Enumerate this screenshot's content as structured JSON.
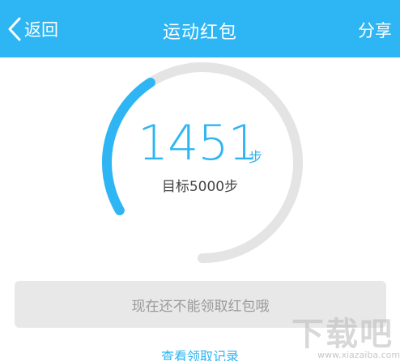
{
  "header": {
    "back_label": "返回",
    "title": "运动红包",
    "share_label": "分享",
    "background_color": "#2eb5f3"
  },
  "progress": {
    "steps": "1451",
    "unit": "步",
    "goal_text": "目标5000步",
    "steps_value": 1451,
    "goal_value": 5000,
    "accent_color": "#2eb5f3",
    "track_color": "#e4e4e4"
  },
  "claim_button": {
    "label": "现在还不能领取红包哦"
  },
  "records_link": {
    "label": "查看领取记录"
  },
  "watermark": {
    "text": "下载吧",
    "url_text": "www.xiazaiba.com"
  },
  "icons": {
    "back": "chevron-left-icon"
  }
}
